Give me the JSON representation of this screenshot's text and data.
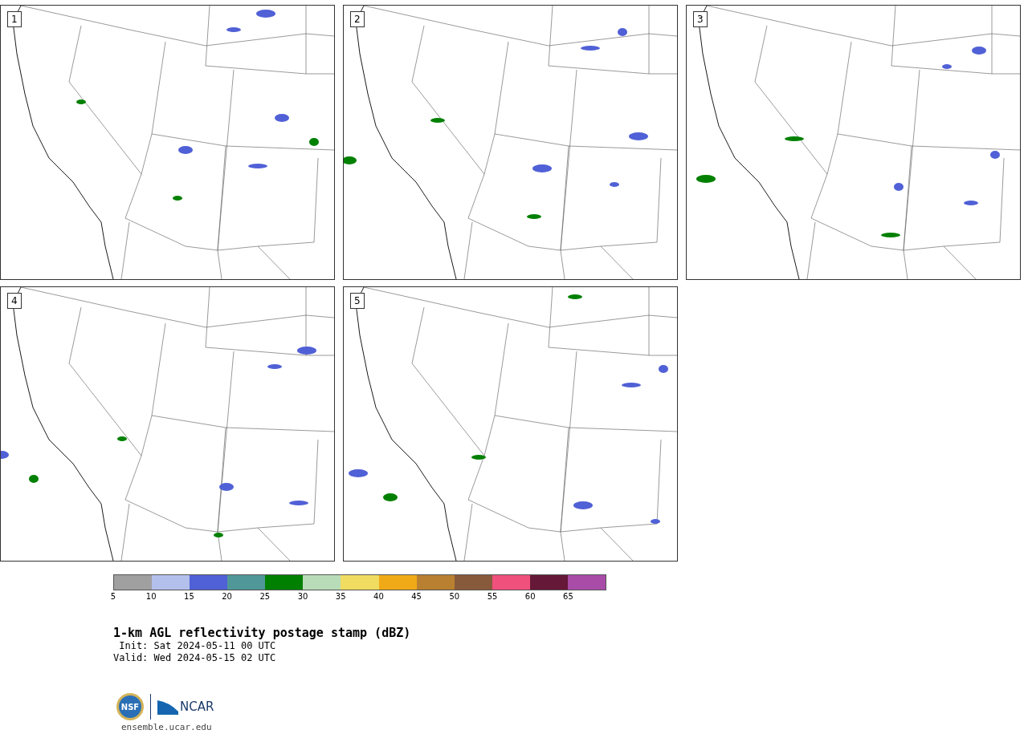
{
  "panels": [
    {
      "label": "1"
    },
    {
      "label": "2"
    },
    {
      "label": "3"
    },
    {
      "label": "4"
    },
    {
      "label": "5"
    }
  ],
  "colorbar": {
    "bins": [
      {
        "color": "#a0a0a0"
      },
      {
        "color": "#b4c0ec"
      },
      {
        "color": "#5060d6"
      },
      {
        "color": "#4f9798"
      },
      {
        "color": "#008000"
      },
      {
        "color": "#b8dcb8"
      },
      {
        "color": "#f0dc60"
      },
      {
        "color": "#f0aa18"
      },
      {
        "color": "#b88030"
      },
      {
        "color": "#885a3c"
      },
      {
        "color": "#f0507c"
      },
      {
        "color": "#661838"
      },
      {
        "color": "#a84ca8"
      }
    ],
    "ticks": [
      "5",
      "10",
      "15",
      "20",
      "25",
      "30",
      "35",
      "40",
      "45",
      "50",
      "55",
      "60",
      "65"
    ]
  },
  "title": "1-km AGL reflectivity postage stamp (dBZ)",
  "init": " Init: Sat 2024-05-11 00 UTC",
  "valid": "Valid: Wed 2024-05-15 02 UTC",
  "logo": {
    "left": "NSF",
    "right": "NCAR"
  },
  "url": "ensemble.ucar.edu"
}
